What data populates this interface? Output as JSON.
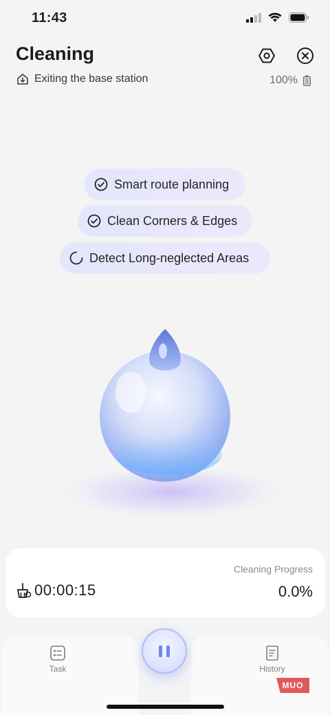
{
  "status": {
    "time": "11:43"
  },
  "header": {
    "title": "Cleaning",
    "subtitle": "Exiting the base station",
    "battery": "100%"
  },
  "features": [
    {
      "label": "Smart route planning",
      "state": "done"
    },
    {
      "label": "Clean Corners & Edges",
      "state": "done"
    },
    {
      "label": "Detect Long-neglected Areas",
      "state": "loading"
    }
  ],
  "progress": {
    "label": "Cleaning Progress",
    "value": "0.0%",
    "elapsed": "00:00:15"
  },
  "tabs": {
    "task": "Task",
    "history": "History"
  },
  "watermark": "MUO",
  "colors": {
    "accent": "#6e86ea",
    "chip": "#e4e6fb",
    "background": "#f4f4f5"
  }
}
